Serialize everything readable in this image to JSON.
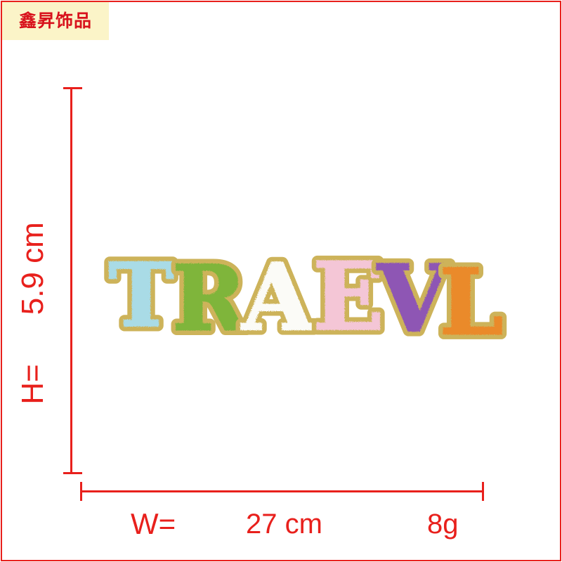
{
  "brand": {
    "text": "鑫昇饰品",
    "background": "#fbf4c8",
    "color": "#d8121c"
  },
  "frame_color": "#e8201c",
  "height_label": {
    "prefix": "H=",
    "value": "5.9 cm"
  },
  "width_label": {
    "prefix": "W=",
    "value": "27 cm",
    "weight": "8g"
  },
  "patch": {
    "letters": [
      {
        "char": "T",
        "color": "#a9dbe6"
      },
      {
        "char": "R",
        "color": "#7fb53a"
      },
      {
        "char": "A",
        "color": "#fbfbf7"
      },
      {
        "char": "E",
        "color": "#f4c6d6"
      },
      {
        "char": "V",
        "color": "#8e57b4"
      },
      {
        "char": "L",
        "color": "#ea8a2c"
      }
    ],
    "border_color": "#cdb35a"
  }
}
